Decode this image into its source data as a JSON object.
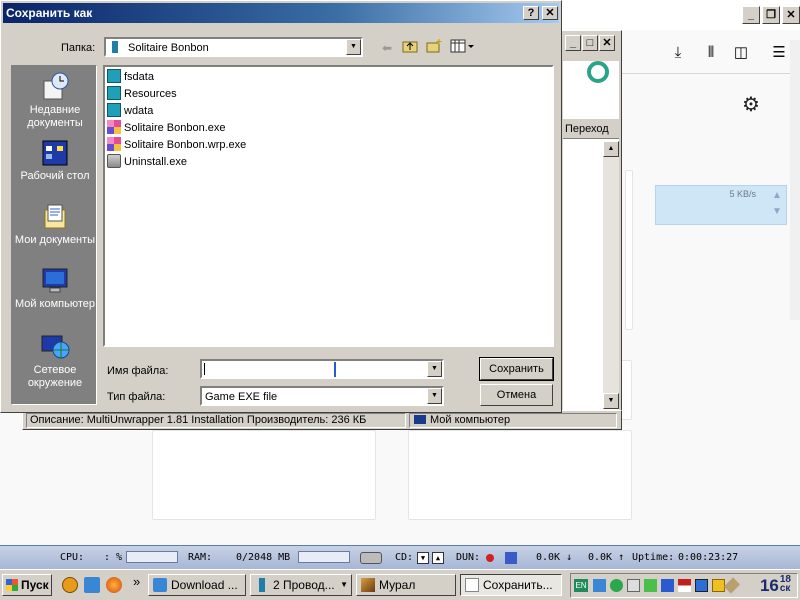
{
  "dialog": {
    "title": "Сохранить как",
    "help_btn": "?",
    "close_btn": "✕",
    "folder_label": "Папка:",
    "folder_value": "Solitaire Bonbon",
    "places": [
      {
        "label": "Недавние документы",
        "icon": "recent-documents-icon"
      },
      {
        "label": "Рабочий стол",
        "icon": "desktop-icon"
      },
      {
        "label": "Мои документы",
        "icon": "my-documents-icon"
      },
      {
        "label": "Мой компьютер",
        "icon": "my-computer-icon"
      },
      {
        "label": "Сетевое окружение",
        "icon": "network-icon"
      }
    ],
    "files": [
      {
        "name": "fsdata",
        "icon": "folder-icon"
      },
      {
        "name": "Resources",
        "icon": "folder-icon"
      },
      {
        "name": "wdata",
        "icon": "folder-icon"
      },
      {
        "name": "Solitaire Bonbon.exe",
        "icon": "exe-icon"
      },
      {
        "name": "Solitaire Bonbon.wrp.exe",
        "icon": "exe-icon"
      },
      {
        "name": "Uninstall.exe",
        "icon": "uninstall-icon"
      }
    ],
    "filename_label": "Имя файла:",
    "filename_value": "",
    "filetype_label": "Тип файла:",
    "filetype_value": "Game EXE file",
    "save_label": "Сохранить",
    "cancel_label": "Отмена"
  },
  "explorer": {
    "goto_label": "Переход",
    "status_description": "Описание: MultiUnwrapper 1.81 Installation Производитель: 236 КБ",
    "status_location": "Мой компьютер"
  },
  "browser": {
    "download_speed": "5 KB/s"
  },
  "sysbar": {
    "cpu_label": "CPU:",
    "cpu_value": ": %",
    "ram_label": "RAM:",
    "ram_value": "0/2048 MB",
    "cd_label": "CD:",
    "dun_label": "DUN:",
    "down_value": "0.0K",
    "up_value": "0.0K",
    "uptime_label": "Uptime:",
    "uptime_value": "0:00:23:27"
  },
  "taskbar": {
    "start_label": "Пуск",
    "more": "»",
    "tasks": [
      {
        "label": "Download ...",
        "active": false
      },
      {
        "label": "2 Провод...",
        "active": false
      },
      {
        "label": "Мурал",
        "active": false
      },
      {
        "label": "Сохранить...",
        "active": true
      }
    ],
    "lang": "EN",
    "clock_hour": "16",
    "clock_min": "18",
    "clock_suffix": "ск"
  }
}
